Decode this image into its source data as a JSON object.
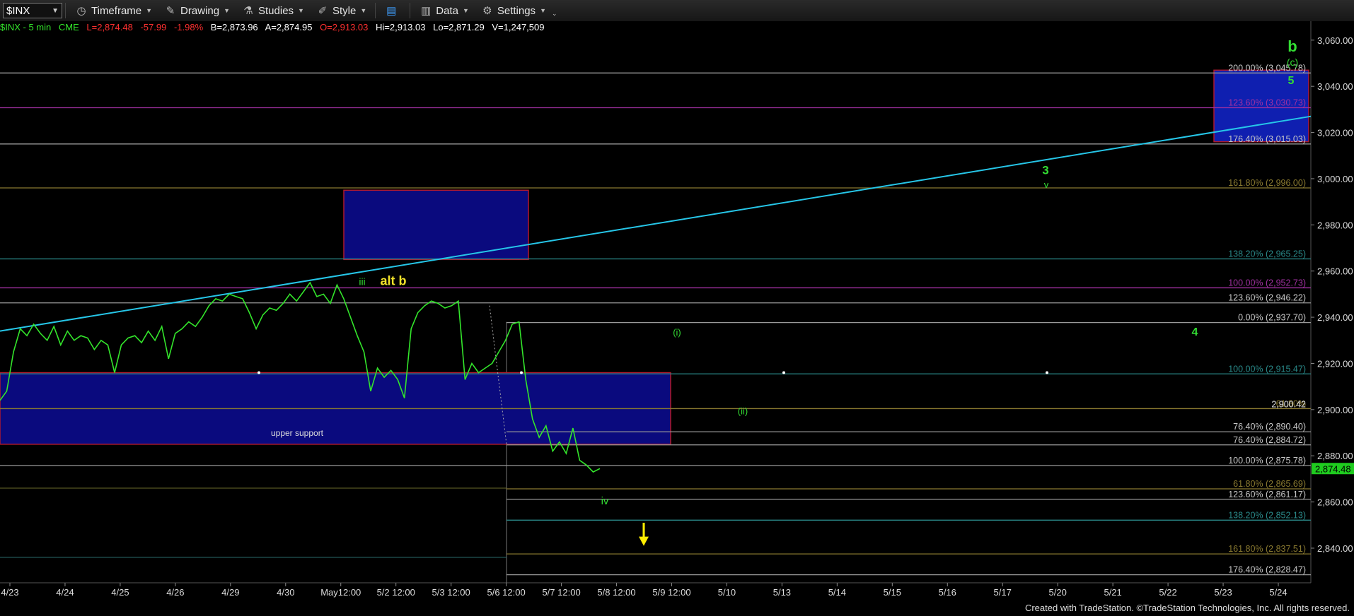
{
  "toolbar": {
    "symbol": "$INX",
    "items": [
      {
        "id": "timeframe",
        "label": "Timeframe",
        "icon": "clock-icon"
      },
      {
        "id": "drawing",
        "label": "Drawing",
        "icon": "pencil-icon"
      },
      {
        "id": "studies",
        "label": "Studies",
        "icon": "flask-icon"
      },
      {
        "id": "style",
        "label": "Style",
        "icon": "brush-icon"
      },
      {
        "id": "layout",
        "label": "",
        "icon": "window-layout-icon"
      },
      {
        "id": "data",
        "label": "Data",
        "icon": "bar-chart-icon"
      },
      {
        "id": "settings",
        "label": "Settings",
        "icon": "gear-icon"
      }
    ]
  },
  "quote": {
    "title": "$INX - 5 min",
    "exchange": "CME",
    "last": "L=2,874.48",
    "change": "-57.99",
    "pct": "-1.98%",
    "bid": "B=2,873.96",
    "ask": "A=2,874.95",
    "open": "O=2,913.03",
    "high": "Hi=2,913.03",
    "low": "Lo=2,871.29",
    "volume": "V=1,247,509"
  },
  "colors": {
    "price": "#33e52b",
    "trendline": "#26c6e8",
    "box_fill": "#0a0a7e",
    "box_border": "#b0192e",
    "up": "#00d000",
    "down": "#ff2020",
    "wave_green": "#33dd33",
    "wave_yellow": "#f2e22a",
    "arrow": "#ffee00",
    "current_price_bg": "#1fcc1f"
  },
  "footer": "Created with TradeStation. ©TradeStation Technologies, Inc. All rights reserved.",
  "chart_data": {
    "type": "line",
    "series": [
      {
        "values": [
          2904,
          2908,
          2925,
          2935,
          2932,
          2937,
          2933,
          2930,
          2936,
          2928,
          2934,
          2930,
          2932,
          2931,
          2926,
          2930,
          2928,
          2916,
          2928,
          2931,
          2932,
          2929,
          2934,
          2930,
          2936,
          2922,
          2933,
          2935,
          2938,
          2936,
          2940,
          2945,
          2948,
          2947,
          2950,
          2949,
          2948,
          2942,
          2935,
          2941,
          2944,
          2943,
          2946,
          2950,
          2947,
          2951,
          2955,
          2949,
          2950,
          2946,
          2954,
          2948,
          2940,
          2932,
          2925,
          2908,
          2918,
          2914,
          2917,
          2913,
          2905,
          2935,
          2942,
          2945,
          2947,
          2946,
          2944,
          2945,
          2947,
          2913,
          2920,
          2916,
          2918,
          2920,
          2925,
          2930,
          2937,
          2938,
          2913,
          2896,
          2888,
          2893,
          2882,
          2886,
          2881,
          2892,
          2878,
          2876,
          2873,
          2874.48
        ]
      }
    ],
    "ylim": [
      2825,
      3063
    ],
    "y_ticks": [
      "3,060.00",
      "3,040.00",
      "3,020.00",
      "3,000.00",
      "2,980.00",
      "2,960.00",
      "2,940.00",
      "2,920.00",
      "2,900.00",
      "2,880.00",
      "2,860.00",
      "2,840.00"
    ],
    "y_tick_values": [
      3060,
      3040,
      3020,
      3000,
      2980,
      2960,
      2940,
      2920,
      2900,
      2880,
      2860,
      2840
    ],
    "x_ticks": [
      "4/23",
      "4/24",
      "4/25",
      "4/26",
      "4/29",
      "4/30",
      "May12:00",
      "5/2 12:00",
      "5/3 12:00",
      "5/6 12:00",
      "5/7 12:00",
      "5/8 12:00",
      "5/9 12:00",
      "5/10",
      "5/13",
      "5/14",
      "5/15",
      "5/16",
      "5/17",
      "5/20",
      "5/21",
      "5/22",
      "5/23",
      "5/24"
    ],
    "current_price": "2,874.48",
    "current_price_value": 2874.48,
    "annotation_price": "2,900.42",
    "annotation_price_value": 2900.42,
    "zone_label": "upper support",
    "fib_levels_right": [
      {
        "label": "200.00% (3,045.78)",
        "value": 3045.78,
        "color": "#9a9a9a"
      },
      {
        "label": "123.60% (3,030.73)",
        "value": 3030.73,
        "color": "#a030a0"
      },
      {
        "label": "176.40% (3,015.03)",
        "value": 3015.03,
        "color": "#9a9a9a"
      },
      {
        "label": "161.80% (2,996.00)",
        "value": 2996.0,
        "color": "#8a7a30"
      },
      {
        "label": "138.20% (2,965.25)",
        "value": 2965.25,
        "color": "#2a8a8a"
      },
      {
        "label": "100.00% (2,952.73)",
        "value": 2952.73,
        "color": "#a030a0"
      },
      {
        "label": "123.60% (2,946.22)",
        "value": 2946.22,
        "color": "#9a9a9a"
      },
      {
        "label": "0.00% (2,937.70)",
        "value": 2937.7,
        "color": "#9a9a9a"
      },
      {
        "label": "100.00% (2,915.47)",
        "value": 2915.47,
        "color": "#2a8a8a"
      },
      {
        "label": "61.80%",
        "value": 2900.42,
        "color": "#8a7a30"
      },
      {
        "label": "76.40% (2,890.40)",
        "value": 2890.4,
        "color": "#9a9a9a"
      },
      {
        "label": "76.40% (2,884.72)",
        "value": 2884.72,
        "color": "#9a9a9a"
      },
      {
        "label": "100.00% (2,875.78)",
        "value": 2875.78,
        "color": "#9a9a9a"
      },
      {
        "label": "61.80% (2,865.69)",
        "value": 2865.69,
        "color": "#8a7a30"
      },
      {
        "label": "123.60% (2,861.17)",
        "value": 2861.17,
        "color": "#9a9a9a"
      },
      {
        "label": "138.20% (2,852.13)",
        "value": 2852.13,
        "color": "#2a8a8a"
      },
      {
        "label": "161.80% (2,837.51)",
        "value": 2837.51,
        "color": "#8a7a30"
      },
      {
        "label": "176.40% (2,828.47)",
        "value": 2828.47,
        "color": "#9a9a9a"
      }
    ],
    "wave_labels": [
      {
        "text": "iii",
        "color": "#33dd33"
      },
      {
        "text": "alt b",
        "color": "#f2e22a"
      },
      {
        "text": "(i)",
        "color": "#33dd33"
      },
      {
        "text": "(ii)",
        "color": "#33dd33"
      },
      {
        "text": "iv",
        "color": "#33dd33"
      },
      {
        "text": "3",
        "color": "#33dd33"
      },
      {
        "text": "v",
        "color": "#33dd33"
      },
      {
        "text": "4",
        "color": "#33dd33"
      },
      {
        "text": "5",
        "color": "#33dd33"
      },
      {
        "text": "b",
        "color": "#33dd33"
      },
      {
        "text": "(c)",
        "color": "#33dd33"
      }
    ]
  }
}
